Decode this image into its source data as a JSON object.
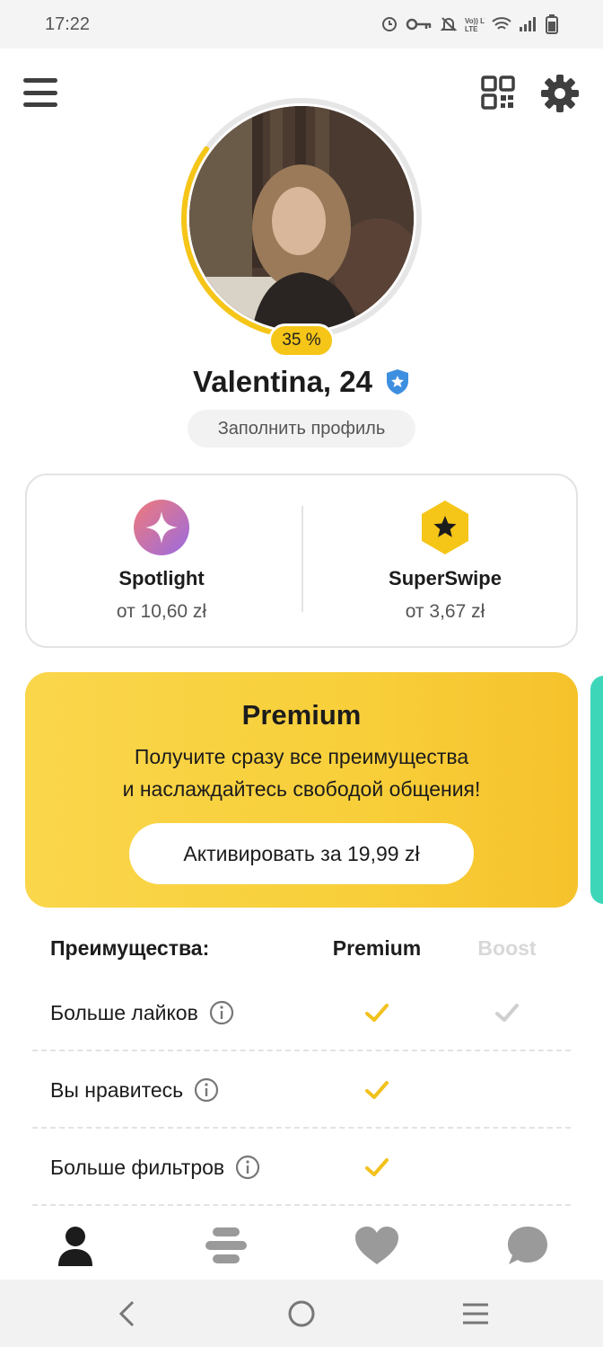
{
  "status_bar": {
    "time": "17:22",
    "icons": [
      "sync-icon",
      "key-icon",
      "bell-off-icon",
      "volte-icon",
      "wifi-icon",
      "signal-icon",
      "battery-icon"
    ],
    "volte_text": "Vo)) LTE"
  },
  "top_bar": {
    "icons": [
      "menu-icon",
      "qr-code-icon",
      "gear-icon"
    ]
  },
  "profile": {
    "completion": "35 %",
    "name": "Valentina, 24",
    "verified_icon": "verified-shield-icon",
    "fill_profile_label": "Заполнить профиль"
  },
  "features": [
    {
      "title": "Spotlight",
      "price": "от 10,60 zł",
      "icon": "sparkle-icon"
    },
    {
      "title": "SuperSwipe",
      "price": "от 3,67 zł",
      "icon": "star-hexagon-icon"
    }
  ],
  "premium": {
    "title": "Premium",
    "description_line1": "Получите сразу все преимущества",
    "description_line2": "и наслаждайтесь свободой общения!",
    "button_label": "Активировать за 19,99 zł"
  },
  "benefits": {
    "header_label": "Преимущества:",
    "col_premium": "Premium",
    "col_boost": "Boost",
    "rows": [
      {
        "label": "Больше лайков",
        "premium": true,
        "boost": true
      },
      {
        "label": "Вы нравитесь",
        "premium": true,
        "boost": false
      },
      {
        "label": "Больше фильтров",
        "premium": true,
        "boost": false
      }
    ]
  },
  "bottom_nav": {
    "items": [
      "profile-icon",
      "swipe-stack-icon",
      "heart-icon",
      "chat-bubble-icon"
    ],
    "active": "profile-icon"
  },
  "system_nav": {
    "items": [
      "back-icon",
      "home-icon",
      "recents-icon"
    ]
  },
  "colors": {
    "accent_yellow": "#f5c518",
    "premium_gradient_start": "#fad64b",
    "premium_gradient_end": "#f6c22c",
    "check_premium": "#f2c11d",
    "check_boost": "#cfcfcf",
    "verified_blue": "#3d8fe0",
    "next_card_teal": "#3ed6b9"
  }
}
